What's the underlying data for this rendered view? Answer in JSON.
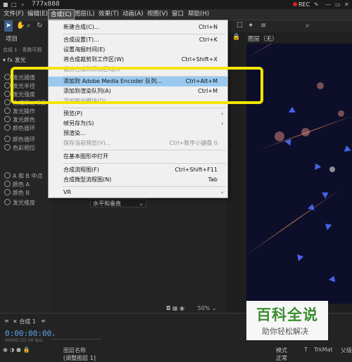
{
  "window": {
    "title": "777x888",
    "rec_label": "REC"
  },
  "menubar": {
    "items": [
      {
        "label": "文件(F)"
      },
      {
        "label": "编辑(E)"
      },
      {
        "label": "合成(C)"
      },
      {
        "label": "图层(L)"
      },
      {
        "label": "效果(T)"
      },
      {
        "label": "动画(A)"
      },
      {
        "label": "视图(V)"
      },
      {
        "label": "窗口"
      },
      {
        "label": "帮助(H)"
      }
    ]
  },
  "left_panel": {
    "tab_project": "项目",
    "breadcrumb": "合成 1 · 青敞可视",
    "effect_group": "发光",
    "properties": [
      "发光阈值",
      "发光半径",
      "发光强度",
      "合成原始项目",
      "发光操作",
      "发光颜色",
      "颜色循环",
      "颜色循环",
      "色彩相位",
      "",
      "A 和 B 中点",
      "颜色 A",
      "颜色 B",
      "发光维度"
    ],
    "glow_dimension_value": "水平和垂直"
  },
  "comp_panel": {
    "tab_layer": "图层（无）",
    "zoom": "50%"
  },
  "dropdown": {
    "items": [
      {
        "label": "新建合成(C)...",
        "shortcut": "Ctrl+N"
      },
      {
        "label": "合成设置(T)...",
        "shortcut": "Ctrl+K"
      },
      {
        "label": "设置海报时间(E)",
        "shortcut": ""
      },
      {
        "label": "将合成裁剪到工作区(W)",
        "shortcut": "Ctrl+Shift+X"
      },
      {
        "label": "裁剪合成到目标区域(I)",
        "shortcut": ""
      },
      {
        "label": "添加到 Adobe Media Encoder 队列...",
        "shortcut": "Ctrl+Alt+M"
      },
      {
        "label": "添加到渲染队列(A)",
        "shortcut": "Ctrl+M"
      },
      {
        "label": "添加输出模块(D)",
        "shortcut": ""
      },
      {
        "label": "预览(P)",
        "shortcut": ""
      },
      {
        "label": "帧另存为(S)",
        "shortcut": ""
      },
      {
        "label": "预渲染...",
        "shortcut": ""
      },
      {
        "label": "保存当前预览(V)...",
        "shortcut": "Ctrl+数字小键盘 0"
      },
      {
        "label": "在基本图形中打开",
        "shortcut": ""
      },
      {
        "label": "合成流程图(F)",
        "shortcut": "Ctrl+Shift+F11"
      },
      {
        "label": "合成微型流程图(N)",
        "shortcut": "Tab"
      },
      {
        "label": "VR",
        "shortcut": ""
      }
    ]
  },
  "timeline": {
    "tab_label": "合成 1",
    "timecode": "0:00:00:00",
    "timecode_sub": "00000 (25.00 fps)",
    "col_layer_name": "图层名称",
    "col_mode": "模式",
    "col_t": "T",
    "col_trkmat": "TrkMat",
    "col_parent": "父级",
    "row_name": "[调整图层 1]",
    "row_mode": "正常"
  },
  "watermark": {
    "line1": "百科全说",
    "line2": "助你轻松解决"
  },
  "colors": {
    "menu_highlight": "#99c9ef",
    "annotation_box": "#f2e600",
    "watermark_green": "#3a8e2e"
  }
}
